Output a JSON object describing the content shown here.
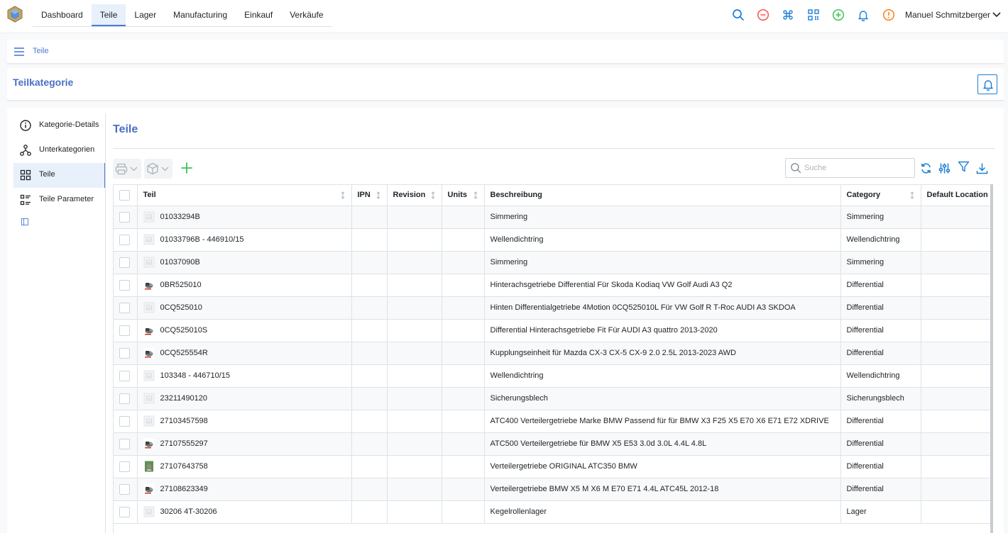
{
  "nav": {
    "tabs": [
      {
        "label": "Dashboard",
        "active": false
      },
      {
        "label": "Teile",
        "active": true
      },
      {
        "label": "Lager",
        "active": false
      },
      {
        "label": "Manufacturing",
        "active": false
      },
      {
        "label": "Einkauf",
        "active": false
      },
      {
        "label": "Verkäufe",
        "active": false
      }
    ],
    "icons": [
      "search-icon",
      "minus-circle-icon",
      "command-icon",
      "qr-code-icon",
      "plus-circle-icon",
      "bell-icon",
      "alert-circle-icon"
    ],
    "user": "Manuel Schmitzberger"
  },
  "breadcrumb": {
    "items": [
      "Teile"
    ]
  },
  "page": {
    "title": "Teilkategorie"
  },
  "sidebar": {
    "items": [
      {
        "label": "Kategorie-Details",
        "icon": "info-icon",
        "active": false
      },
      {
        "label": "Unterkategorien",
        "icon": "sitemap-icon",
        "active": false
      },
      {
        "label": "Teile",
        "icon": "grid-icon",
        "active": true
      },
      {
        "label": "Teile Parameter",
        "icon": "list-details-icon",
        "active": false
      }
    ]
  },
  "content": {
    "title": "Teile",
    "search_placeholder": "Suche"
  },
  "colors": {
    "accent": "#4a7bd5",
    "title": "#4a6fc4",
    "add_green": "#40c057",
    "icon_blue": "#1c7ed6",
    "danger_red": "#fa5252",
    "warning_orange": "#fd7e14"
  },
  "table": {
    "columns": [
      "Teil",
      "IPN",
      "Revision",
      "Units",
      "Beschreibung",
      "Category",
      "Default Location"
    ],
    "rows": [
      {
        "teil": "01033294B",
        "ipn": "",
        "revision": "",
        "units": "",
        "beschreibung": "Simmering",
        "category": "Simmering",
        "location": "",
        "thumb": "placeholder"
      },
      {
        "teil": "01033796B - 446910/15",
        "ipn": "",
        "revision": "",
        "units": "",
        "beschreibung": "Wellendichtring",
        "category": "Wellendichtring",
        "location": "",
        "thumb": "placeholder"
      },
      {
        "teil": "01037090B",
        "ipn": "",
        "revision": "",
        "units": "",
        "beschreibung": "Simmering",
        "category": "Simmering",
        "location": "",
        "thumb": "placeholder"
      },
      {
        "teil": "0BR525010",
        "ipn": "",
        "revision": "",
        "units": "",
        "beschreibung": "Hinterachsgetriebe Differential Für Skoda Kodiaq VW Golf Audi A3 Q2",
        "category": "Differential",
        "location": "",
        "thumb": "photo"
      },
      {
        "teil": "0CQ525010",
        "ipn": "",
        "revision": "",
        "units": "",
        "beschreibung": "Hinten Differentialgetriebe 4Motion 0CQ525010L Für VW Golf R T-Roc AUDI A3 SKDOA",
        "category": "Differential",
        "location": "",
        "thumb": "placeholder"
      },
      {
        "teil": "0CQ525010S",
        "ipn": "",
        "revision": "",
        "units": "",
        "beschreibung": "Differential Hinterachsgetriebe Fit Für AUDI A3 quattro 2013-2020",
        "category": "Differential",
        "location": "",
        "thumb": "photo"
      },
      {
        "teil": "0CQ525554R",
        "ipn": "",
        "revision": "",
        "units": "",
        "beschreibung": "Kupplungseinheit für Mazda CX-3 CX-5 CX-9 2.0 2.5L 2013-2023 AWD",
        "category": "Differential",
        "location": "",
        "thumb": "photo"
      },
      {
        "teil": "103348 - 446710/15",
        "ipn": "",
        "revision": "",
        "units": "",
        "beschreibung": "Wellendichtring",
        "category": "Wellendichtring",
        "location": "",
        "thumb": "placeholder"
      },
      {
        "teil": "23211490120",
        "ipn": "",
        "revision": "",
        "units": "",
        "beschreibung": "Sicherungsblech",
        "category": "Sicherungsblech",
        "location": "",
        "thumb": "placeholder"
      },
      {
        "teil": "27103457598",
        "ipn": "",
        "revision": "",
        "units": "",
        "beschreibung": "ATC400 Verteilergetriebe Marke BMW Passend für für BMW X3 F25 X5 E70 X6 E71 E72 XDRIVE",
        "category": "Differential",
        "location": "",
        "thumb": "placeholder"
      },
      {
        "teil": "27107555297",
        "ipn": "",
        "revision": "",
        "units": "",
        "beschreibung": "ATC500 Verteilergetriebe für BMW X5 E53 3.0d 3.0L 4.4L 4.8L",
        "category": "Differential",
        "location": "",
        "thumb": "photo"
      },
      {
        "teil": "27107643758",
        "ipn": "",
        "revision": "",
        "units": "",
        "beschreibung": "Verteilergetriebe ORIGINAL ATC350 BMW",
        "category": "Differential",
        "location": "",
        "thumb": "photo-green"
      },
      {
        "teil": "27108623349",
        "ipn": "",
        "revision": "",
        "units": "",
        "beschreibung": "Verteilergetriebe BMW X5 M X6 M E70 E71 4.4L ATC45L 2012-18",
        "category": "Differential",
        "location": "",
        "thumb": "photo"
      },
      {
        "teil": "30206 4T-30206",
        "ipn": "",
        "revision": "",
        "units": "",
        "beschreibung": "Kegelrollenlager",
        "category": "Lager",
        "location": "",
        "thumb": "placeholder"
      }
    ]
  }
}
